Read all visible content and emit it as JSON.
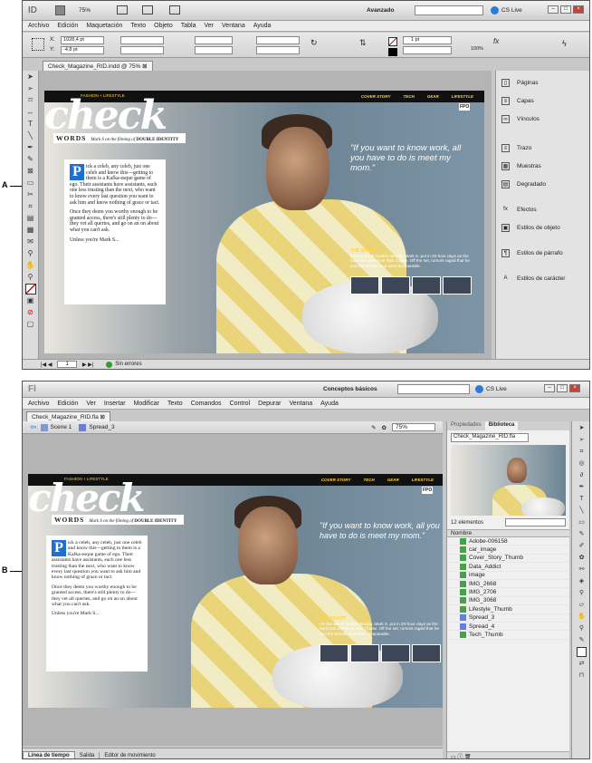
{
  "callouts": {
    "a": "A",
    "b": "B"
  },
  "indesign": {
    "logo": "ID",
    "zoom": "75%",
    "workspace": "Avanzado",
    "cs_live": "CS Live",
    "menu": [
      "Archivo",
      "Edición",
      "Maquetación",
      "Texto",
      "Objeto",
      "Tabla",
      "Ver",
      "Ventana",
      "Ayuda"
    ],
    "fields": {
      "x": "1028,4 pt",
      "y": "-4,8 pt",
      "stroke": "1 pt",
      "pct": "100%"
    },
    "x_label": "X:",
    "y_label": "Y:",
    "doc_tab": "Check_Magazine_RID.indd @ 75%",
    "panels": [
      "Páginas",
      "Capas",
      "Vínculos",
      "Trazo",
      "Muestras",
      "Degradado",
      "Efectos",
      "Estilos de objeto",
      "Estilos de párrafo",
      "Estilos de carácter"
    ],
    "status": {
      "page": "1",
      "preflight": "Sin errores"
    }
  },
  "flash": {
    "logo": "Fl",
    "workspace": "Conceptos básicos",
    "cs_live": "CS Live",
    "menu": [
      "Archivo",
      "Edición",
      "Ver",
      "Insertar",
      "Modificar",
      "Texto",
      "Comandos",
      "Control",
      "Depurar",
      "Ventana",
      "Ayuda"
    ],
    "doc_tab": "Check_Magazine_RID.fla",
    "scene": "Scene 1",
    "symbol": "Spread_3",
    "zoom": "75%",
    "bottom_tabs": [
      "Línea de tiempo",
      "Salida",
      "Editor de movimiento"
    ],
    "panel_tabs": [
      "Propiedades",
      "Biblioteca"
    ],
    "library_doc": "Check_Magazine_RID.fla",
    "library_count": "12 elementos",
    "library_header": "Nombre",
    "library_items": [
      "Adobe-006158",
      "car_image",
      "Cover_Story_Thumb",
      "Data_Addict",
      "image",
      "IMG_2668",
      "IMG_2706",
      "IMG_3068",
      "Lifestyle_Thumb",
      "Spread_3",
      "Spread_4",
      "Tech_Thumb"
    ]
  },
  "magazine": {
    "banner": [
      "COVER STORY",
      "TECH",
      "GEAR",
      "LIFESTYLE"
    ],
    "fashion": "FASHION + LIFESTYLE",
    "masthead": "check",
    "fpo": "FPO",
    "words": "WORDS",
    "tagline": "Mark S on the filming of",
    "tagline_title": "DOUBLE IDENTITY",
    "dropcap": "P",
    "para1": "ick a celeb, any celeb, just one celeb and know this—getting to them is a Kafka-esque game of ego. Their assistants have assistants, each one less trusting than the next, who want to know every last question you want to ask him and know nothing of grace or tact.",
    "para2": "Once they deem you worthy enough to be granted access, there's still plenty to do—they vet all queries, and go on an on about what you can't ask.",
    "para3": "Unless you're Mark S...",
    "quote": "\"If you want to know work, all you have to do is meet my mom.\"",
    "shoot_title": "THE SHOOT",
    "shoot_text": "On the set of Double Identity, Mark S. put in 20-hour days as the hard luck detective Rick Chase. Off the set, rumors raged that he and the female lead were inseparable."
  }
}
